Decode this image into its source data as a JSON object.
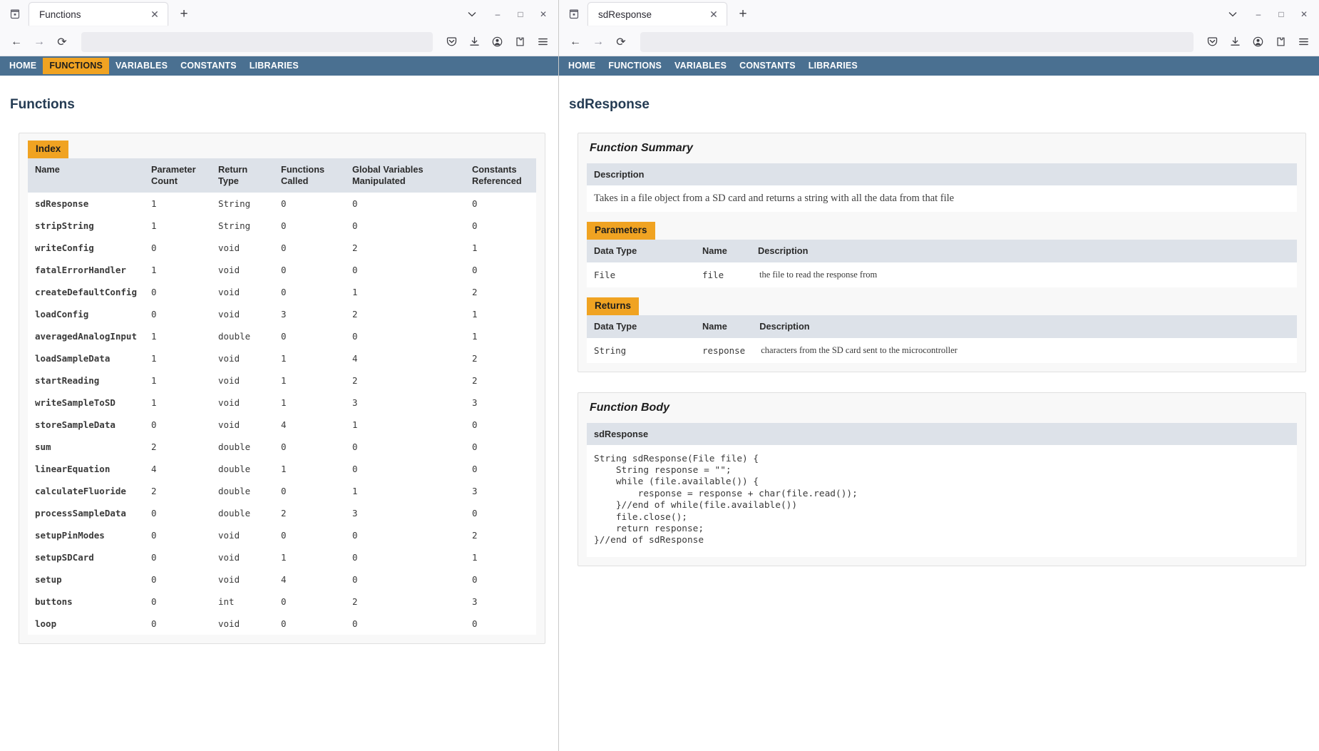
{
  "windows": {
    "left": {
      "tab": {
        "title": "Functions",
        "close_label": "✕",
        "newtab_label": "+"
      },
      "urlbar": {
        "value": "",
        "placeholder": ""
      },
      "nav": {
        "back": "←",
        "forward": "→",
        "reload": "⟳",
        "pocket": "save-to-pocket",
        "downloads": "downloads",
        "account": "account",
        "extensions": "extensions",
        "menu": "☰"
      },
      "controls": {
        "minimize": "–",
        "maximize": "□",
        "close": "✕",
        "list_tabs": "⌵"
      },
      "pagenav": [
        {
          "label": "HOME",
          "active": false
        },
        {
          "label": "FUNCTIONS",
          "active": true
        },
        {
          "label": "VARIABLES",
          "active": false
        },
        {
          "label": "CONSTANTS",
          "active": false
        },
        {
          "label": "LIBRARIES",
          "active": false
        }
      ],
      "page": {
        "title": "Functions",
        "index_badge": "Index",
        "columns": [
          "Name",
          "Parameter Count",
          "Return Type",
          "Functions Called",
          "Global Variables Manipulated",
          "Constants Referenced"
        ],
        "rows": [
          {
            "name": "sdResponse",
            "params": "1",
            "return": "String",
            "calls": "0",
            "globals": "0",
            "constants": "0"
          },
          {
            "name": "stripString",
            "params": "1",
            "return": "String",
            "calls": "0",
            "globals": "0",
            "constants": "0"
          },
          {
            "name": "writeConfig",
            "params": "0",
            "return": "void",
            "calls": "0",
            "globals": "2",
            "constants": "1"
          },
          {
            "name": "fatalErrorHandler",
            "params": "1",
            "return": "void",
            "calls": "0",
            "globals": "0",
            "constants": "0"
          },
          {
            "name": "createDefaultConfig",
            "params": "0",
            "return": "void",
            "calls": "0",
            "globals": "1",
            "constants": "2"
          },
          {
            "name": "loadConfig",
            "params": "0",
            "return": "void",
            "calls": "3",
            "globals": "2",
            "constants": "1"
          },
          {
            "name": "averagedAnalogInput",
            "params": "1",
            "return": "double",
            "calls": "0",
            "globals": "0",
            "constants": "1"
          },
          {
            "name": "loadSampleData",
            "params": "1",
            "return": "void",
            "calls": "1",
            "globals": "4",
            "constants": "2"
          },
          {
            "name": "startReading",
            "params": "1",
            "return": "void",
            "calls": "1",
            "globals": "2",
            "constants": "2"
          },
          {
            "name": "writeSampleToSD",
            "params": "1",
            "return": "void",
            "calls": "1",
            "globals": "3",
            "constants": "3"
          },
          {
            "name": "storeSampleData",
            "params": "0",
            "return": "void",
            "calls": "4",
            "globals": "1",
            "constants": "0"
          },
          {
            "name": "sum",
            "params": "2",
            "return": "double",
            "calls": "0",
            "globals": "0",
            "constants": "0"
          },
          {
            "name": "linearEquation",
            "params": "4",
            "return": "double",
            "calls": "1",
            "globals": "0",
            "constants": "0"
          },
          {
            "name": "calculateFluoride",
            "params": "2",
            "return": "double",
            "calls": "0",
            "globals": "1",
            "constants": "3"
          },
          {
            "name": "processSampleData",
            "params": "0",
            "return": "double",
            "calls": "2",
            "globals": "3",
            "constants": "0"
          },
          {
            "name": "setupPinModes",
            "params": "0",
            "return": "void",
            "calls": "0",
            "globals": "0",
            "constants": "2"
          },
          {
            "name": "setupSDCard",
            "params": "0",
            "return": "void",
            "calls": "1",
            "globals": "0",
            "constants": "1"
          },
          {
            "name": "setup",
            "params": "0",
            "return": "void",
            "calls": "4",
            "globals": "0",
            "constants": "0"
          },
          {
            "name": "buttons",
            "params": "0",
            "return": "int",
            "calls": "0",
            "globals": "2",
            "constants": "3"
          },
          {
            "name": "loop",
            "params": "0",
            "return": "void",
            "calls": "0",
            "globals": "0",
            "constants": "0"
          }
        ]
      }
    },
    "right": {
      "tab": {
        "title": "sdResponse",
        "close_label": "✕",
        "newtab_label": "+"
      },
      "urlbar": {
        "value": "",
        "placeholder": ""
      },
      "nav": {
        "back": "←",
        "forward": "→",
        "reload": "⟳",
        "pocket": "save-to-pocket",
        "downloads": "downloads",
        "account": "account",
        "extensions": "extensions",
        "menu": "☰"
      },
      "controls": {
        "minimize": "–",
        "maximize": "□",
        "close": "✕",
        "list_tabs": "⌵"
      },
      "pagenav": [
        {
          "label": "HOME",
          "active": false
        },
        {
          "label": "FUNCTIONS",
          "active": false
        },
        {
          "label": "VARIABLES",
          "active": false
        },
        {
          "label": "CONSTANTS",
          "active": false
        },
        {
          "label": "LIBRARIES",
          "active": false
        }
      ],
      "page": {
        "title": "sdResponse",
        "summary": {
          "heading": "Function Summary",
          "description_header": "Description",
          "description": "Takes in a file object from a SD card and returns a string with all the data from that file",
          "parameters_badge": "Parameters",
          "parameters_columns": [
            "Data Type",
            "Name",
            "Description"
          ],
          "parameters_rows": [
            {
              "type": "File",
              "name": "file",
              "description": "the file to read the response from"
            }
          ],
          "returns_badge": "Returns",
          "returns_columns": [
            "Data Type",
            "Name",
            "Description"
          ],
          "returns_rows": [
            {
              "type": "String",
              "name": "response",
              "description": "characters from the SD card sent to the microcontroller"
            }
          ]
        },
        "body": {
          "heading": "Function Body",
          "name_header": "sdResponse",
          "code": "String sdResponse(File file) {\n    String response = \"\";\n    while (file.available()) {\n        response = response + char(file.read());\n    }//end of while(file.available())\n    file.close();\n    return response;\n}//end of sdResponse"
        }
      }
    }
  },
  "colors": {
    "nav_bar": "#4a7091",
    "accent_orange": "#f0a322",
    "table_header": "#dde2e9",
    "title_color": "#243b53",
    "link_color": "#2c5d8f"
  }
}
